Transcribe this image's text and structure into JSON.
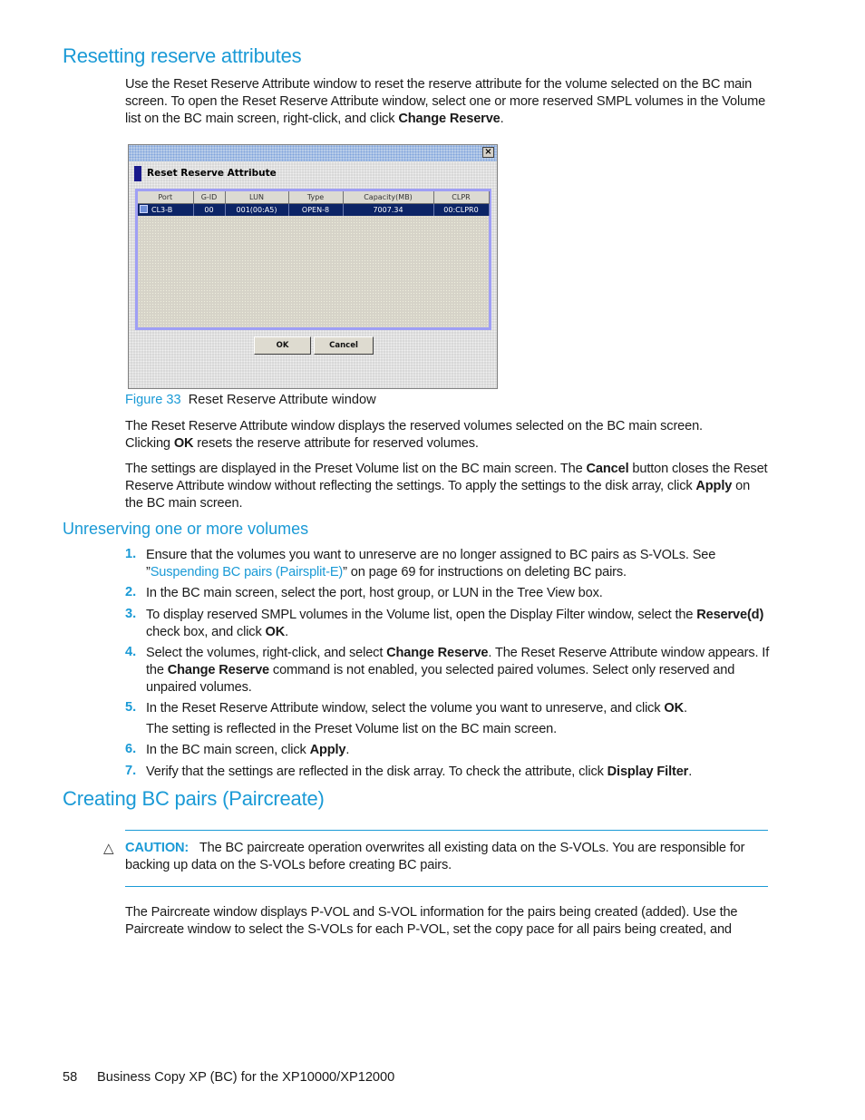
{
  "section1": {
    "heading": "Resetting reserve attributes",
    "intro": {
      "pre": "Use the Reset Reserve Attribute window to reset the reserve attribute for the volume selected on the BC main screen. To open the Reset Reserve Attribute window, select one or more reserved SMPL volumes in the Volume list on the BC main screen, right-click, and click ",
      "bold": "Change Reserve",
      "post": "."
    }
  },
  "dialog": {
    "title_bar": "",
    "close_glyph": "×",
    "heading": "Reset Reserve Attribute",
    "columns": [
      "Port",
      "G-ID",
      "LUN",
      "Type",
      "Capacity(MB)",
      "CLPR"
    ],
    "rows": [
      {
        "icon": "volume-icon",
        "port": "CL3-B",
        "gid": "00",
        "lun": "001(00:A5)",
        "type": "OPEN-8",
        "capacity": "7007.34",
        "clpr": "00:CLPR0",
        "selected": true
      }
    ],
    "ok_label": "OK",
    "cancel_label": "Cancel"
  },
  "figure": {
    "label": "Figure 33",
    "caption": "Reset Reserve Attribute window"
  },
  "para2": {
    "line1": "The Reset Reserve Attribute window displays the reserved volumes selected on the BC main screen.",
    "pre": "Clicking ",
    "bold": "OK",
    "post": " resets the reserve attribute for reserved volumes."
  },
  "para3": {
    "pre": "The settings are displayed in the Preset Volume list on the BC main screen. The ",
    "bold1": "Cancel",
    "mid": " button closes the Reset Reserve Attribute window without reflecting the settings. To apply the settings to the disk array, click ",
    "bold2": "Apply",
    "post": " on the BC main screen."
  },
  "section2": {
    "heading": "Unreserving one or more volumes",
    "steps": [
      {
        "num": "1.",
        "pre": "Ensure that the volumes you want to unreserve are no longer assigned to BC pairs as S-VOLs. See ”",
        "link": "Suspending BC pairs (Pairsplit-E)",
        "post": "” on page 69 for instructions on deleting BC pairs."
      },
      {
        "num": "2.",
        "text": "In the BC main screen, select the port, host group, or LUN in the Tree View box."
      },
      {
        "num": "3.",
        "pre": "To display reserved SMPL volumes in the Volume list, open the Display Filter window, select the ",
        "bold1": "Reserve(d)",
        "mid": " check box, and click ",
        "bold2": "OK",
        "post": "."
      },
      {
        "num": "4.",
        "pre": "Select the volumes, right-click, and select ",
        "bold1": "Change Reserve",
        "mid": ". The Reset Reserve Attribute window appears. If the ",
        "bold2": "Change Reserve",
        "post": " command is not enabled, you selected paired volumes. Select only reserved and unpaired volumes."
      },
      {
        "num": "5.",
        "pre": "In the Reset Reserve Attribute window, select the volume you want to unreserve, and click ",
        "bold": "OK",
        "post": ".",
        "note": "The setting is reflected in the Preset Volume list on the BC main screen."
      },
      {
        "num": "6.",
        "pre": "In the BC main screen, click ",
        "bold": "Apply",
        "post": "."
      },
      {
        "num": "7.",
        "pre": "Verify that the settings are reflected in the disk array. To check the attribute, click ",
        "bold": "Display Filter",
        "post": "."
      }
    ]
  },
  "section3": {
    "heading": "Creating BC pairs (Paircreate)",
    "caution": {
      "icon": "warning-triangle-icon",
      "glyph": "△",
      "label": "CAUTION:",
      "text": "The BC paircreate operation overwrites all existing data on the S-VOLs. You are responsible for backing up data on the S-VOLs before creating BC pairs."
    },
    "para": "The Paircreate window displays P-VOL and S-VOL information for the pairs being created (added). Use the Paircreate window to select the S-VOLs for each P-VOL, set the copy pace for all pairs being created, and"
  },
  "footer": {
    "page_number": "58",
    "title": "Business Copy XP (BC) for the XP10000/XP12000"
  }
}
